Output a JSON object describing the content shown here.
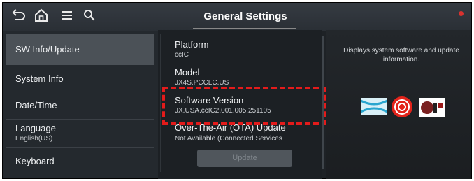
{
  "header": {
    "title": "General Settings"
  },
  "sidebar": {
    "items": [
      {
        "label": "SW Info/Update",
        "active": true
      },
      {
        "label": "System Info"
      },
      {
        "label": "Date/Time"
      },
      {
        "label": "Language",
        "sub": "English(US)"
      },
      {
        "label": "Keyboard"
      }
    ]
  },
  "main": {
    "platform": {
      "label": "Platform",
      "value": "ccIC"
    },
    "model": {
      "label": "Model",
      "value": "JX4S.PCCLC.US"
    },
    "software": {
      "label": "Software Version",
      "value": "JX.USA.ccIC2.001.005.251105"
    },
    "ota": {
      "label": "Over-The-Air (OTA) Update",
      "value": "Not Available (Connected Services"
    },
    "update_button": "Update"
  },
  "right_panel": {
    "description": "Displays system software and update information."
  },
  "colors": {
    "highlight": "#e31b1b",
    "status_dot": "#d8322f"
  },
  "icons": [
    "back-icon",
    "home-icon",
    "menu-icon",
    "search-icon",
    "blue-wave-logo",
    "red-dot-logo",
    "ir52-award-logo"
  ]
}
